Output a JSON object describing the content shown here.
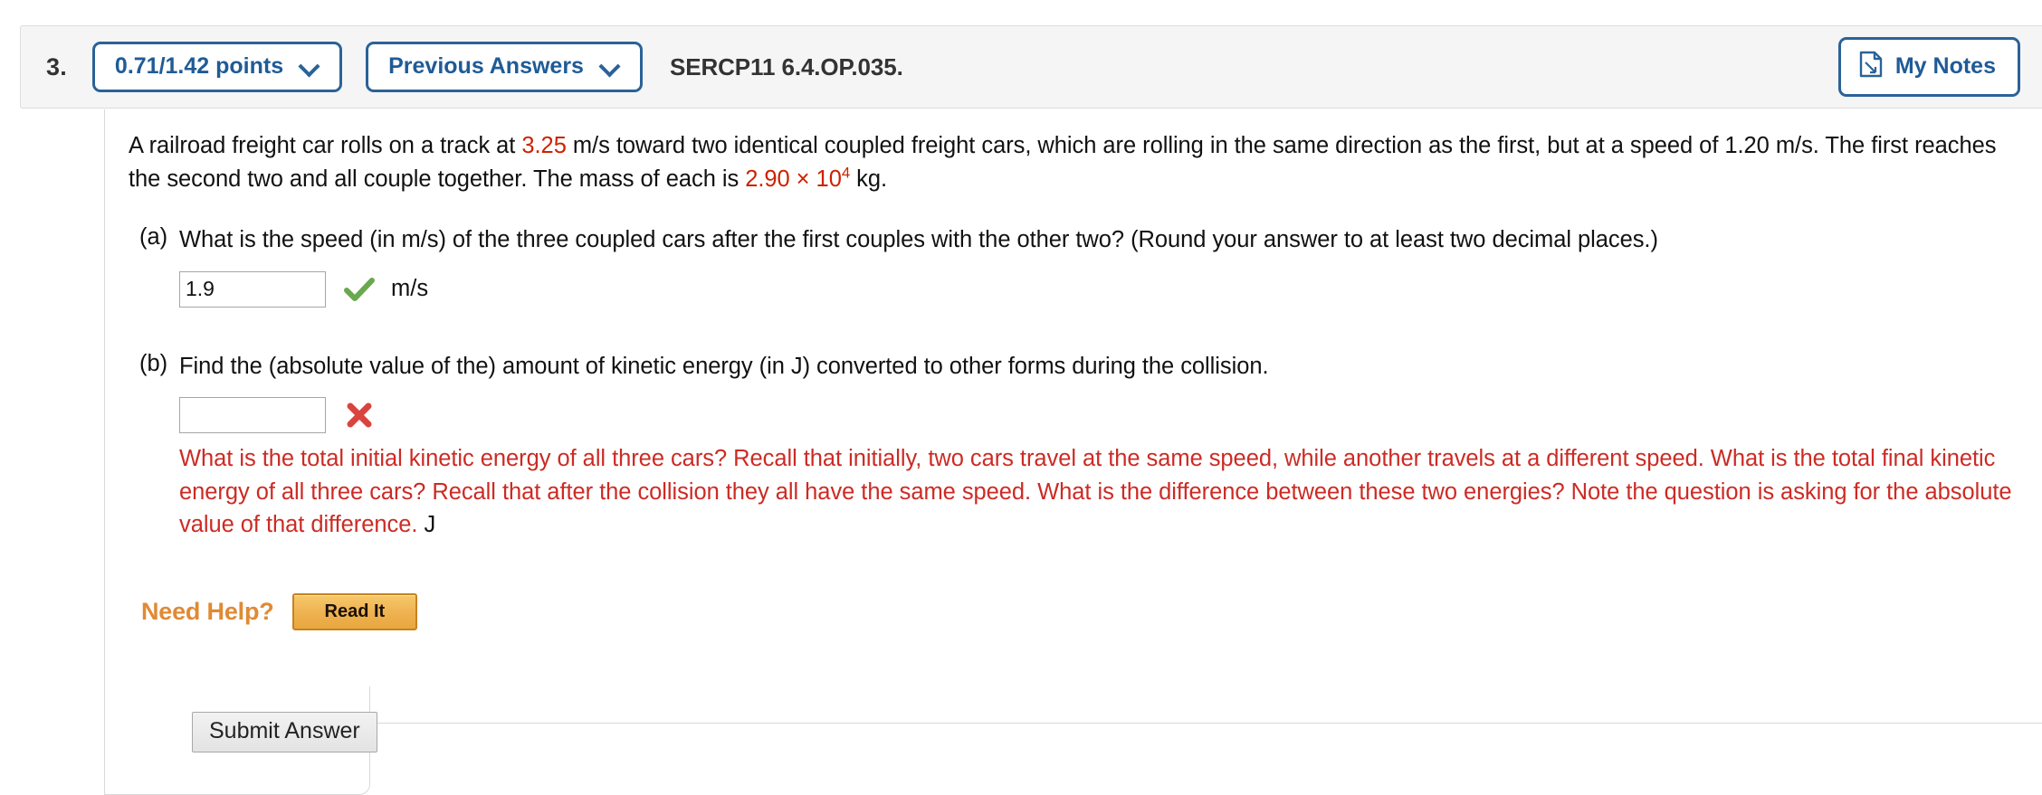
{
  "header": {
    "question_number": "3.",
    "points_label": "0.71/1.42 points",
    "previous_answers_label": "Previous Answers",
    "question_code": "SERCP11 6.4.OP.035.",
    "my_notes_label": "My Notes",
    "icons": {
      "chevron": "chevron-down-icon",
      "notes": "notes-page-icon"
    },
    "colors": {
      "accent_blue": "#1f5b96",
      "border_blue": "#2b6298",
      "bar_background": "#f5f5f5"
    }
  },
  "question": {
    "stem_part1": "A railroad freight car rolls on a track at ",
    "stem_value1": "3.25",
    "stem_part2": " m/s toward two identical coupled freight cars, which are rolling in the same direction as the first, but at a speed of 1.20 m/s. The first reaches the second two and all couple together. The mass of each is ",
    "stem_value2_mantissa": "2.90 × 10",
    "stem_value2_exponent": "4",
    "stem_part3": " kg."
  },
  "parts": [
    {
      "label": "(a)",
      "text": "What is the speed (in m/s) of the three coupled cars after the first couples with the other two? (Round your answer to at least two decimal places.)",
      "answer_value": "1.9",
      "answer_placeholder": "",
      "status": "correct",
      "status_icon": "green-check-icon",
      "unit": "m/s",
      "feedback": ""
    },
    {
      "label": "(b)",
      "text": "Find the (absolute value of the) amount of kinetic energy (in J) converted to other forms during the collision.",
      "answer_value": "",
      "answer_placeholder": "",
      "status": "incorrect",
      "status_icon": "red-x-icon",
      "unit": "J",
      "feedback": "What is the total initial kinetic energy of all three cars? Recall that initially, two cars travel at the same speed, while another travels at a different speed. What is the total final kinetic energy of all three cars? Recall that after the collision they all have the same speed. What is the difference between these two energies? Note the question is asking for the absolute value of that difference."
    }
  ],
  "need_help": {
    "label": "Need Help?",
    "read_it_label": "Read It",
    "label_color": "#e08a34"
  },
  "footer": {
    "submit_label": "Submit Answer"
  },
  "status_colors": {
    "correct_green": "#6aa84f",
    "incorrect_red": "#d9534f",
    "value_red": "#cc2200",
    "feedback_red": "#cc2b24"
  }
}
